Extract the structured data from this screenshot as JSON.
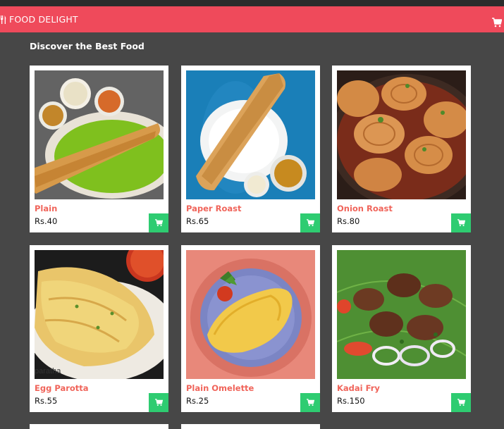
{
  "navbar": {
    "brand": "FOOD DELIGHT",
    "brand_icon": "utensils-icon",
    "cart_icon": "cart-icon"
  },
  "heading": "Discover the Best Food",
  "colors": {
    "navbar": "#ef4a5b",
    "background": "#474747",
    "item_name": "#f0645a",
    "cart_button": "#2ecc71"
  },
  "items": [
    {
      "name": "Plain",
      "price": "Rs.40",
      "image": "plain dosa with chutneys"
    },
    {
      "name": "Paper Roast",
      "price": "Rs.65",
      "image": "paper roast dosa"
    },
    {
      "name": "Onion Roast",
      "price": "Rs.80",
      "image": "onion roast"
    },
    {
      "name": "Egg Parotta",
      "price": "Rs.55",
      "image": "egg parotta",
      "image_caption": "paratha"
    },
    {
      "name": "Plain Omelette",
      "price": "Rs.25",
      "image": "plain omelette"
    },
    {
      "name": "Kadai Fry",
      "price": "Rs.150",
      "image": "kadai fry"
    }
  ]
}
